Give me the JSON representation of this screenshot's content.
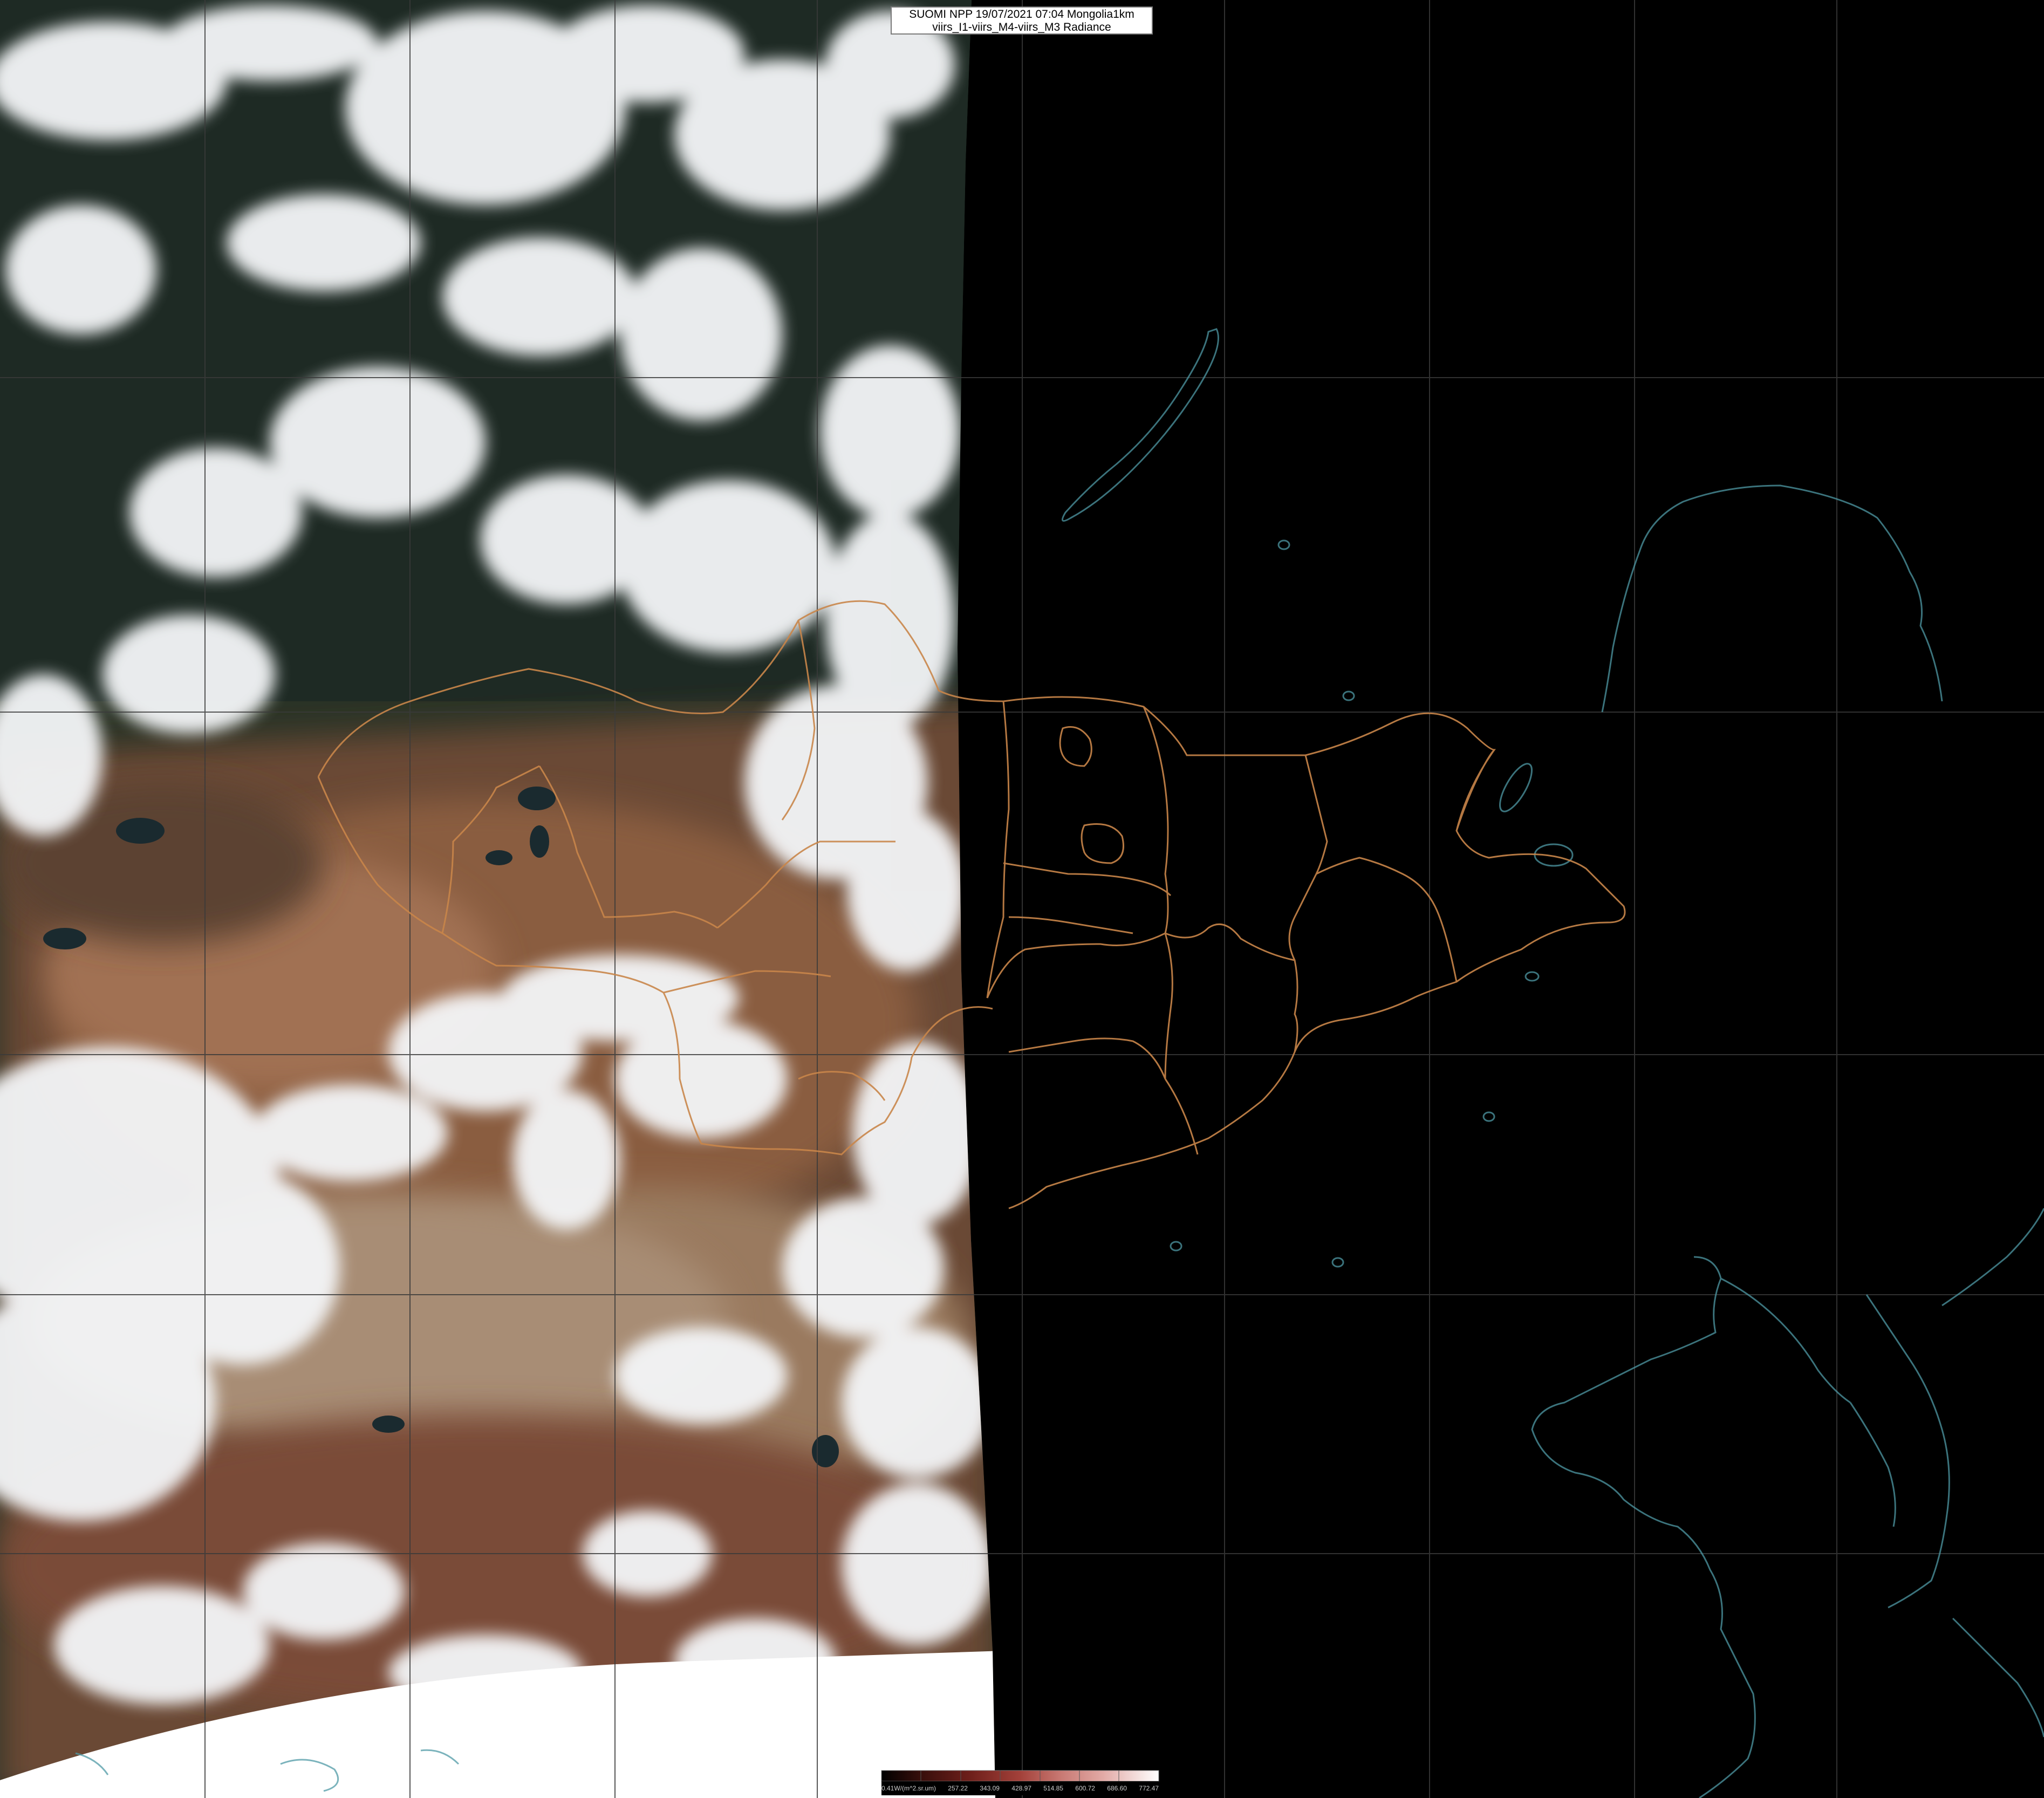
{
  "header": {
    "line1": "SUOMI NPP 19/07/2021 07:04 Mongolia1km",
    "line2": "viirs_I1-viirs_M4-viirs_M3 Radiance"
  },
  "legend": {
    "ticks": [
      "0.41W/(m^2.sr.um)",
      "257.22",
      "343.09",
      "428.97",
      "514.85",
      "600.72",
      "686.60",
      "772.47"
    ],
    "colors": [
      "#000000",
      "#3a0f0c",
      "#6e1f1a",
      "#a3413a",
      "#c97a74",
      "#e2aaa6",
      "#f2d2d0",
      "#ffffff"
    ]
  },
  "palette": {
    "border_orange": "#c9864a",
    "coast_cyan": "#4f9aa6",
    "grid_gray": "#3a3a3a",
    "cloud_white": "#f4f6f8"
  }
}
